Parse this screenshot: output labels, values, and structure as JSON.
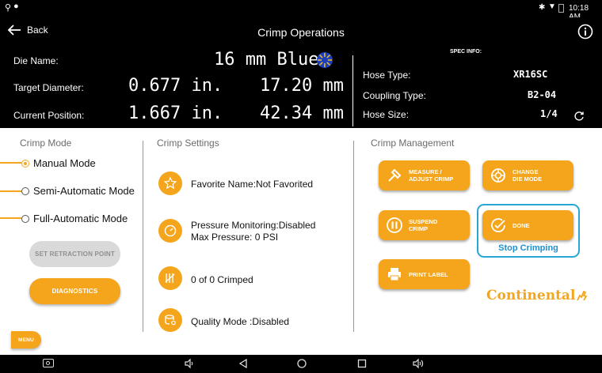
{
  "status_bar": {
    "time": "10:18 AM"
  },
  "app_bar": {
    "back_label": "Back",
    "title": "Crimp Operations"
  },
  "info": {
    "die_name_label": "Die Name:",
    "die_name_value": "16 mm Blue",
    "target_label": "Target Diameter:",
    "target_in": "0.677 in.",
    "target_mm": "17.20 mm",
    "current_label": "Current Position:",
    "current_in": "1.667 in.",
    "current_mm": "42.34 mm",
    "spec_info_label": "SPEC INFO:",
    "hose_type_label": "Hose Type:",
    "hose_type_value": "XR16SC",
    "coupling_type_label": "Coupling Type:",
    "coupling_type_value": "B2-04",
    "hose_size_label": "Hose Size:",
    "hose_size_value": "1/4"
  },
  "crimp_mode": {
    "title": "Crimp Mode",
    "options": [
      "Manual Mode",
      "Semi-Automatic Mode",
      "Full-Automatic Mode"
    ],
    "selected": "Manual Mode",
    "set_retraction_label": "SET RETRACTION POINT",
    "diagnostics_label": "DIAGNOSTICS"
  },
  "crimp_settings": {
    "title": "Crimp Settings",
    "favorite_text": "Favorite Name:Not Favorited",
    "pressure_line1": "Pressure Monitoring:Disabled",
    "pressure_line2": "Max Pressure: 0 PSI",
    "crimped_text": "0 of 0 Crimped",
    "quality_text": "Quality Mode :Disabled"
  },
  "crimp_management": {
    "title": "Crimp Management",
    "measure_line1": "MEASURE /",
    "measure_line2": "ADJUST CRIMP",
    "change_line1": "CHANGE",
    "change_line2": "DIE MODE",
    "suspend_line1": "SUSPEND",
    "suspend_line2": "CRIMP",
    "done_label": "DONE",
    "stop_crimping_label": "Stop Crimping",
    "print_label": "PRINT LABEL",
    "brand": "Continental"
  },
  "menu_label": "MENU",
  "colors": {
    "accent": "#f5a51c",
    "highlight_border": "#29a6d6",
    "stop_text": "#1f8fd0",
    "disabled": "#d9d9d9"
  }
}
